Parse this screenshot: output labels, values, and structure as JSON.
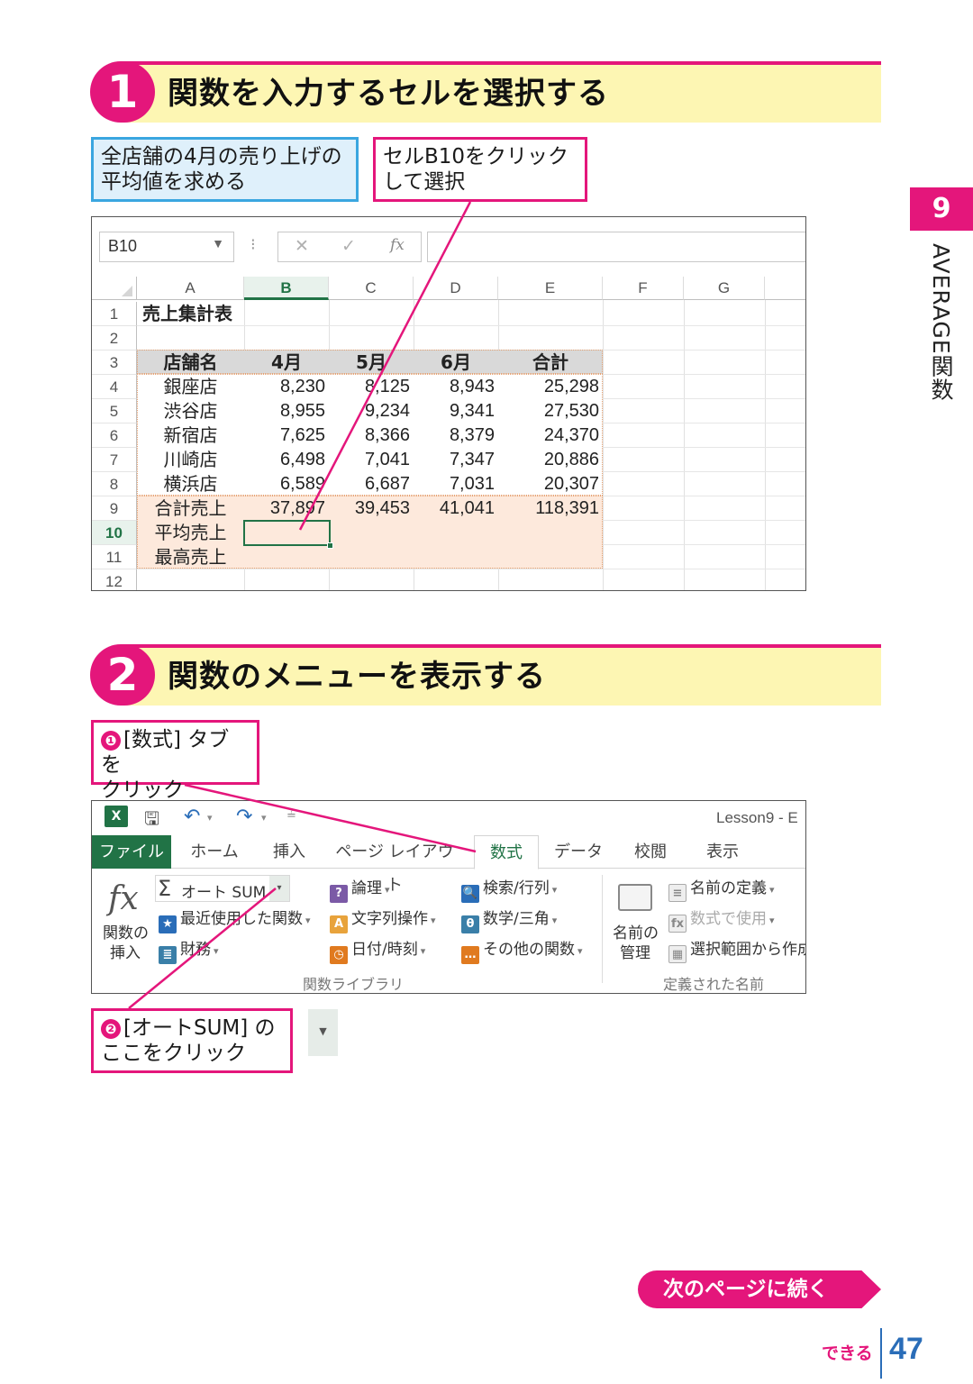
{
  "step1": {
    "number": "1",
    "title": "関数を入力するセルを選択する"
  },
  "callouts1": {
    "blue": "全店舗の4月の売り上げの\n平均値を求める",
    "pink": "セルB10をクリック\nして選択"
  },
  "side": {
    "chapter": "9",
    "label": "AVERAGE関数"
  },
  "sheet": {
    "namebox": "B10",
    "fx": "fx",
    "columns": [
      "A",
      "B",
      "C",
      "D",
      "E",
      "F",
      "G"
    ],
    "selected_column": "B",
    "rows": [
      "1",
      "2",
      "3",
      "4",
      "5",
      "6",
      "7",
      "8",
      "9",
      "10",
      "11",
      "12"
    ],
    "selected_row": "10",
    "title": "売上集計表",
    "headers": [
      "店舗名",
      "4月",
      "5月",
      "6月",
      "合計"
    ],
    "data": [
      [
        "銀座店",
        "8,230",
        "8,125",
        "8,943",
        "25,298"
      ],
      [
        "渋谷店",
        "8,955",
        "9,234",
        "9,341",
        "27,530"
      ],
      [
        "新宿店",
        "7,625",
        "8,366",
        "8,379",
        "24,370"
      ],
      [
        "川崎店",
        "6,498",
        "7,041",
        "7,347",
        "20,886"
      ],
      [
        "横浜店",
        "6,589",
        "6,687",
        "7,031",
        "20,307"
      ],
      [
        "合計売上",
        "37,897",
        "39,453",
        "41,041",
        "118,391"
      ]
    ],
    "avg_label": "平均売上",
    "max_label": "最高売上"
  },
  "step2": {
    "number": "2",
    "title": "関数のメニューを表示する"
  },
  "callouts2": {
    "tab_bullet": "❶",
    "tab_text": "[数式] タブを\nクリック",
    "autosum_bullet": "❷",
    "autosum_text": "[オートSUM] の\nここをクリック"
  },
  "ribbon": {
    "window_title": "Lesson9 - E",
    "tabs": [
      "ファイル",
      "ホーム",
      "挿入",
      "ページ レイアウト",
      "数式",
      "データ",
      "校閲",
      "表示"
    ],
    "active_tab": "数式",
    "insert_fn": [
      "関数の",
      "挿入"
    ],
    "autosum": "オート SUM",
    "recent": "最近使用した関数",
    "financial": "財務",
    "logical": "論理",
    "text": "文字列操作",
    "datetime": "日付/時刻",
    "lookup": "検索/行列",
    "math": "数学/三角",
    "other": "その他の関数",
    "name_mgr": [
      "名前の",
      "管理"
    ],
    "define_name": "名前の定義",
    "use_in_formula": "数式で使用",
    "create_from_sel": "選択範囲から作成",
    "group1": "関数ライブラリ",
    "group2": "定義された名前"
  },
  "footer": {
    "next": "次のページに続く",
    "brand": "できる",
    "page": "47"
  },
  "colors": {
    "accent": "#e4167b",
    "excel_green": "#217346",
    "band": "#fdf6b3",
    "blue_callout": "#dff0fb"
  }
}
